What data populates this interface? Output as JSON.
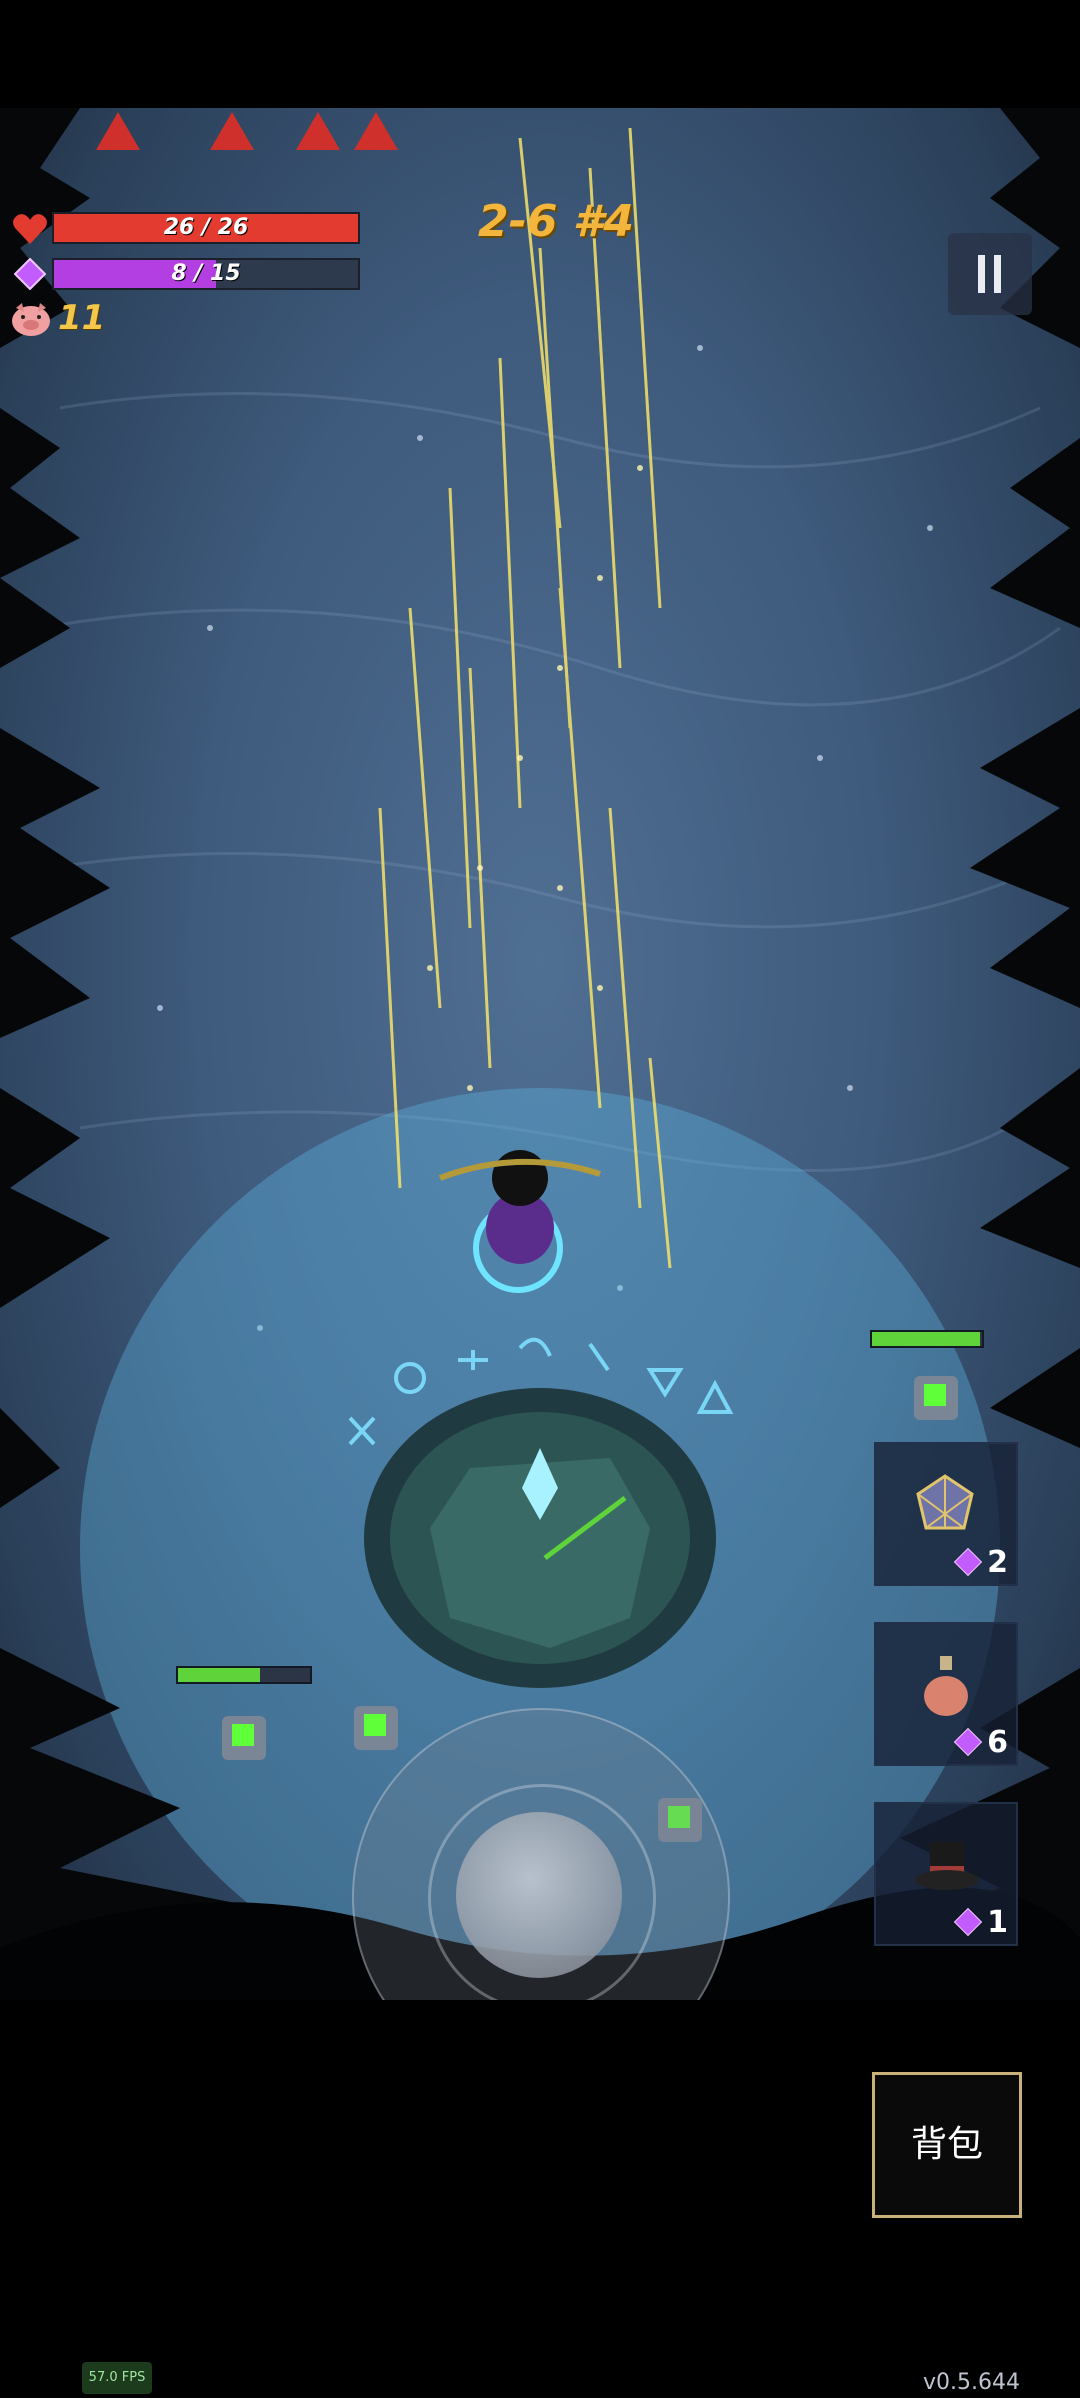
{
  "hud": {
    "hp_text": "26 / 26",
    "hp_current": 26,
    "hp_max": 26,
    "mana_text": "8 / 15",
    "mana_current": 8,
    "mana_max": 15,
    "coins": "11",
    "level": "2-6 #4"
  },
  "colors": {
    "hp": "#e33b2f",
    "mana": "#b33fe3",
    "coins": "#f4c64a",
    "level": "#f3b53b",
    "enemy_hp": "#5fd33a"
  },
  "icons": {
    "hp": "heart-icon",
    "mana": "diamond-gem-icon",
    "coins": "pig-icon",
    "pause": "pause-icon"
  },
  "inventory": [
    {
      "name": "crystal-cage",
      "cost": "2"
    },
    {
      "name": "potion-bottle",
      "cost": "6"
    },
    {
      "name": "top-hat",
      "cost": "1"
    }
  ],
  "bag_label": "背包",
  "fps": "57.0 FPS",
  "version": "v0.5.644",
  "enemy_health": [
    0.62,
    0.98
  ]
}
